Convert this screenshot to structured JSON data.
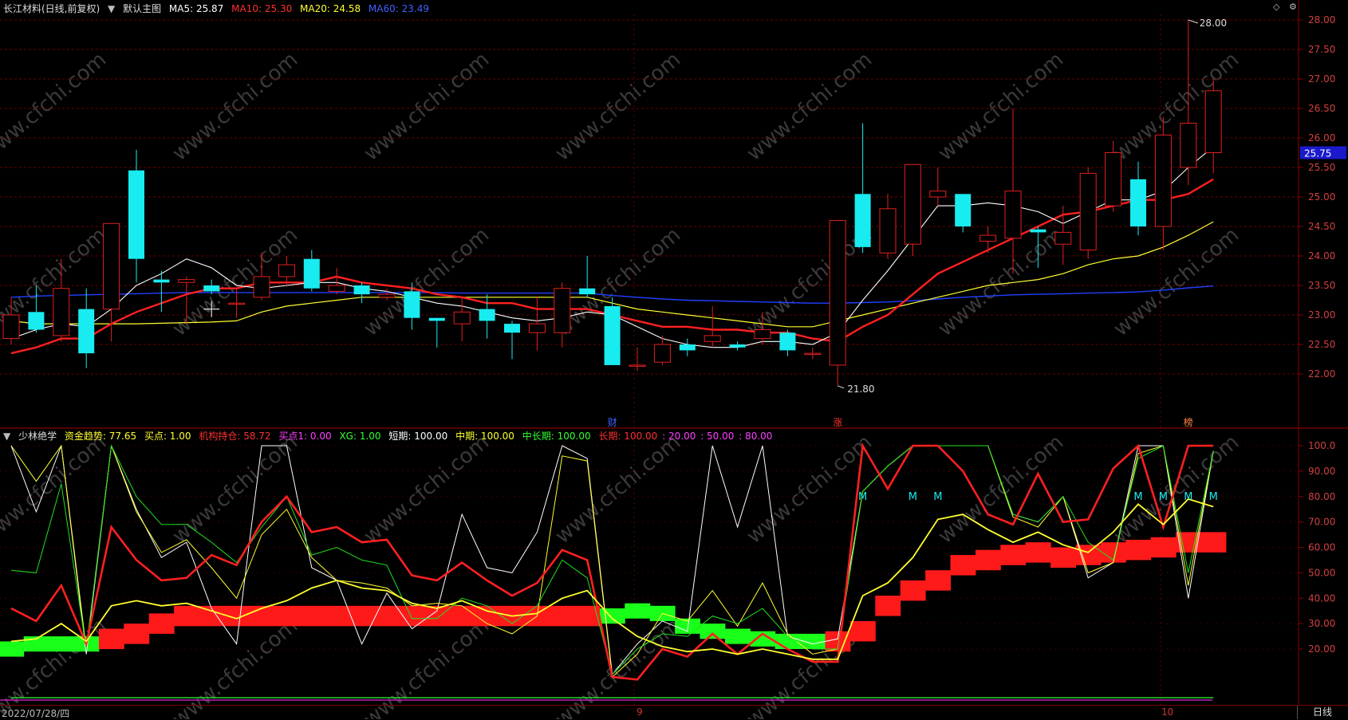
{
  "colors": {
    "up": "#e02020",
    "down": "#19ecf0",
    "ma5": "#ffffff",
    "ma10": "#ff2020",
    "ma20": "#ffff30",
    "ma60": "#2040ff",
    "grid": "#6a0000",
    "axis_text": "#d04040"
  },
  "main_header": {
    "stock": "长江材料(日线,前复权)",
    "menu_icon": "circle-dropdown-icon",
    "chart_name": "默认主图",
    "ma5": "MA5: 25.87",
    "ma10": "MA10: 25.30",
    "ma20": "MA20: 24.58",
    "ma60": "MA60: 23.49"
  },
  "indicator_header": {
    "menu_icon": "circle-dropdown-icon",
    "name": "少林绝学",
    "fund_trend": "资金趋势: 77.65",
    "buy_point": "买点: 1.00",
    "inst_holding": "机构持仓: 58.72",
    "buy_point1": "买点1: 0.00",
    "xg": "XG: 1.00",
    "short_term": "短期: 100.00",
    "mid_term": "中期: 100.00",
    "mid_long_term": "中长期: 100.00",
    "long_term": "长期: 100.00",
    "p20": ": 20.00",
    "p50": ": 50.00",
    "p80": ": 80.00"
  },
  "price_axis": {
    "ticks": [
      "28.00",
      "27.50",
      "27.00",
      "26.50",
      "26.00",
      "25.50",
      "25.00",
      "24.50",
      "24.00",
      "23.50",
      "23.00",
      "22.50",
      "22.00"
    ],
    "current_price": "25.75"
  },
  "indicator_axis": {
    "ticks": [
      "100.0",
      "90.00",
      "80.00",
      "70.00",
      "60.00",
      "50.00",
      "40.00",
      "30.00",
      "20.00"
    ]
  },
  "annotations": {
    "high": "28.00",
    "low": "21.80",
    "m_markers": [
      "M",
      "M",
      "M",
      "M",
      "M",
      "M",
      "M"
    ],
    "event_cai": "财",
    "event_zhang": "涨",
    "event_bang": "榜"
  },
  "watermark": "www.cfchi.com",
  "bottom_bar": {
    "date": "2022/07/28/四",
    "month_9": "9",
    "month_10": "10",
    "period": "日线"
  },
  "chart_data": [
    {
      "type": "candlestick",
      "ylim": [
        21.6,
        28.3
      ],
      "candles": [
        {
          "o": 22.6,
          "c": 23.0,
          "h": 23.3,
          "l": 22.5
        },
        {
          "o": 23.05,
          "c": 22.75,
          "h": 23.5,
          "l": 22.7
        },
        {
          "o": 22.65,
          "c": 23.45,
          "h": 23.95,
          "l": 22.55
        },
        {
          "o": 23.1,
          "c": 22.35,
          "h": 23.45,
          "l": 22.1
        },
        {
          "o": 23.1,
          "c": 24.55,
          "h": 24.55,
          "l": 22.55
        },
        {
          "o": 25.45,
          "c": 23.95,
          "h": 25.8,
          "l": 23.55
        },
        {
          "o": 23.6,
          "c": 23.55,
          "h": 23.75,
          "l": 23.05
        },
        {
          "o": 23.55,
          "c": 23.6,
          "h": 23.65,
          "l": 22.85
        },
        {
          "o": 23.5,
          "c": 23.4,
          "h": 23.6,
          "l": 23.35
        },
        {
          "o": 23.2,
          "c": 23.2,
          "h": 23.45,
          "l": 22.95
        },
        {
          "o": 23.3,
          "c": 23.65,
          "h": 24.05,
          "l": 23.25
        },
        {
          "o": 23.65,
          "c": 23.85,
          "h": 24.0,
          "l": 23.5
        },
        {
          "o": 23.95,
          "c": 23.45,
          "h": 24.1,
          "l": 23.4
        },
        {
          "o": 23.4,
          "c": 23.5,
          "h": 23.8,
          "l": 23.35
        },
        {
          "o": 23.5,
          "c": 23.35,
          "h": 23.55,
          "l": 23.2
        },
        {
          "o": 23.3,
          "c": 23.35,
          "h": 23.45,
          "l": 23.25
        },
        {
          "o": 23.4,
          "c": 22.95,
          "h": 23.55,
          "l": 22.75
        },
        {
          "o": 22.95,
          "c": 22.9,
          "h": 22.95,
          "l": 22.45
        },
        {
          "o": 22.85,
          "c": 23.05,
          "h": 23.3,
          "l": 22.55
        },
        {
          "o": 23.1,
          "c": 22.9,
          "h": 23.35,
          "l": 22.6
        },
        {
          "o": 22.85,
          "c": 22.7,
          "h": 22.9,
          "l": 22.25
        },
        {
          "o": 22.7,
          "c": 22.85,
          "h": 23.3,
          "l": 22.4
        },
        {
          "o": 22.7,
          "c": 23.45,
          "h": 23.55,
          "l": 22.45
        },
        {
          "o": 23.45,
          "c": 23.35,
          "h": 24.0,
          "l": 23.3
        },
        {
          "o": 23.15,
          "c": 22.15,
          "h": 23.3,
          "l": 22.15
        },
        {
          "o": 22.15,
          "c": 22.15,
          "h": 22.45,
          "l": 22.05
        },
        {
          "o": 22.2,
          "c": 22.5,
          "h": 22.65,
          "l": 22.15
        },
        {
          "o": 22.5,
          "c": 22.4,
          "h": 22.6,
          "l": 22.3
        },
        {
          "o": 22.55,
          "c": 22.65,
          "h": 23.15,
          "l": 22.45
        },
        {
          "o": 22.5,
          "c": 22.45,
          "h": 22.55,
          "l": 22.4
        },
        {
          "o": 22.6,
          "c": 22.75,
          "h": 23.05,
          "l": 22.5
        },
        {
          "o": 22.7,
          "c": 22.4,
          "h": 22.75,
          "l": 22.3
        },
        {
          "o": 22.35,
          "c": 22.35,
          "h": 22.45,
          "l": 22.25
        },
        {
          "o": 22.15,
          "c": 24.6,
          "h": 24.6,
          "l": 21.8
        },
        {
          "o": 25.05,
          "c": 24.15,
          "h": 26.25,
          "l": 24.05
        },
        {
          "o": 24.05,
          "c": 24.8,
          "h": 25.05,
          "l": 23.95
        },
        {
          "o": 24.2,
          "c": 25.55,
          "h": 25.55,
          "l": 24.0
        },
        {
          "o": 25.0,
          "c": 25.1,
          "h": 25.5,
          "l": 24.85
        },
        {
          "o": 25.05,
          "c": 24.5,
          "h": 25.05,
          "l": 24.4
        },
        {
          "o": 24.25,
          "c": 24.35,
          "h": 24.5,
          "l": 24.05
        },
        {
          "o": 24.3,
          "c": 25.1,
          "h": 26.5,
          "l": 23.7
        },
        {
          "o": 24.45,
          "c": 24.4,
          "h": 24.5,
          "l": 23.8
        },
        {
          "o": 24.2,
          "c": 24.4,
          "h": 24.85,
          "l": 23.85
        },
        {
          "o": 24.1,
          "c": 25.4,
          "h": 25.5,
          "l": 23.95
        },
        {
          "o": 24.85,
          "c": 25.75,
          "h": 25.95,
          "l": 24.75
        },
        {
          "o": 25.3,
          "c": 24.5,
          "h": 25.6,
          "l": 24.35
        },
        {
          "o": 24.5,
          "c": 26.05,
          "h": 26.35,
          "l": 24.1
        },
        {
          "o": 25.5,
          "c": 26.25,
          "h": 28.0,
          "l": 25.2
        },
        {
          "o": 25.75,
          "c": 26.8,
          "h": 27.0,
          "l": 25.4
        }
      ],
      "ma5": [
        22.6,
        22.75,
        22.85,
        22.8,
        23.1,
        23.5,
        23.7,
        23.95,
        23.8,
        23.5,
        23.45,
        23.5,
        23.55,
        23.55,
        23.45,
        23.4,
        23.3,
        23.2,
        23.15,
        23.05,
        22.95,
        22.9,
        22.95,
        23.05,
        23.0,
        22.8,
        22.6,
        22.5,
        22.45,
        22.45,
        22.55,
        22.55,
        22.5,
        22.7,
        23.25,
        23.75,
        24.3,
        24.85,
        24.85,
        24.9,
        24.85,
        24.75,
        24.55,
        24.75,
        24.95,
        24.95,
        25.1,
        25.5,
        25.85
      ],
      "ma10": [
        22.35,
        22.45,
        22.6,
        22.6,
        22.85,
        23.05,
        23.2,
        23.35,
        23.45,
        23.45,
        23.55,
        23.55,
        23.55,
        23.65,
        23.55,
        23.5,
        23.45,
        23.35,
        23.3,
        23.2,
        23.2,
        23.1,
        23.1,
        23.1,
        23.0,
        22.9,
        22.8,
        22.8,
        22.75,
        22.75,
        22.7,
        22.7,
        22.6,
        22.55,
        22.8,
        23.0,
        23.35,
        23.7,
        23.9,
        24.1,
        24.3,
        24.5,
        24.7,
        24.75,
        24.85,
        24.95,
        24.95,
        25.05,
        25.3
      ],
      "ma20": [
        22.9,
        22.85,
        22.85,
        22.85,
        22.85,
        22.85,
        22.86,
        22.87,
        22.88,
        22.9,
        23.05,
        23.15,
        23.2,
        23.25,
        23.3,
        23.3,
        23.3,
        23.3,
        23.3,
        23.3,
        23.3,
        23.3,
        23.3,
        23.3,
        23.2,
        23.1,
        23.05,
        23.0,
        22.95,
        22.9,
        22.85,
        22.8,
        22.8,
        22.9,
        23.0,
        23.1,
        23.2,
        23.3,
        23.4,
        23.5,
        23.55,
        23.6,
        23.7,
        23.85,
        23.95,
        24.0,
        24.15,
        24.35,
        24.58
      ],
      "ma60": [
        23.3,
        23.32,
        23.33,
        23.34,
        23.35,
        23.36,
        23.37,
        23.38,
        23.38,
        23.38,
        23.38,
        23.38,
        23.38,
        23.38,
        23.38,
        23.38,
        23.38,
        23.38,
        23.37,
        23.37,
        23.37,
        23.37,
        23.37,
        23.37,
        23.33,
        23.3,
        23.27,
        23.25,
        23.24,
        23.23,
        23.22,
        23.21,
        23.2,
        23.2,
        23.21,
        23.22,
        23.24,
        23.27,
        23.3,
        23.32,
        23.34,
        23.35,
        23.36,
        23.37,
        23.38,
        23.39,
        23.42,
        23.46,
        23.49
      ]
    },
    {
      "type": "line",
      "ylim": [
        0,
        102
      ],
      "series": [
        {
          "name": "短期",
          "values": [
            100,
            74,
            100,
            18,
            100,
            75,
            56,
            62,
            36,
            22,
            100,
            100,
            52,
            47,
            22,
            42,
            28,
            35,
            73,
            52,
            50,
            66,
            100,
            95,
            10,
            22,
            31,
            27,
            100,
            68,
            100,
            25,
            22,
            24,
            82,
            92,
            100,
            100,
            100,
            100,
            73,
            70,
            80,
            48,
            54,
            100,
            100,
            40,
            98
          ]
        },
        {
          "name": "中期",
          "values": [
            100,
            86,
            100,
            20,
            100,
            74,
            58,
            63,
            52,
            40,
            65,
            75,
            56,
            47,
            46,
            44,
            37,
            38,
            37,
            30,
            26,
            33,
            96,
            94,
            9,
            18,
            34,
            31,
            43,
            29,
            46,
            26,
            18,
            20,
            82,
            92,
            100,
            100,
            100,
            100,
            72,
            68,
            80,
            50,
            54,
            97,
            100,
            45,
            98
          ]
        },
        {
          "name": "中长期",
          "values": [
            51,
            50,
            85,
            20,
            100,
            80,
            69,
            69,
            62,
            54,
            68,
            80,
            57,
            60,
            55,
            53,
            32,
            32,
            40,
            37,
            30,
            37,
            55,
            48,
            10,
            20,
            26,
            25,
            33,
            30,
            36,
            25,
            20,
            20,
            82,
            92,
            100,
            100,
            100,
            100,
            73,
            70,
            80,
            62,
            55,
            95,
            100,
            50,
            98
          ]
        },
        {
          "name": "长期",
          "values": [
            36,
            31,
            45,
            22,
            68,
            55,
            47,
            48,
            57,
            53,
            70,
            80,
            66,
            68,
            62,
            63,
            49,
            47,
            54,
            47,
            41,
            46,
            59,
            55,
            9,
            8,
            20,
            17,
            26,
            18,
            26,
            20,
            15,
            15,
            100,
            83,
            100,
            100,
            90,
            73,
            69,
            89,
            70,
            71,
            91,
            100,
            68,
            100,
            100
          ]
        },
        {
          "name": "资金趋势",
          "values": [
            23,
            24,
            30,
            23,
            37,
            39,
            37,
            38,
            35,
            32,
            36,
            39,
            44,
            47,
            44,
            43,
            38,
            36,
            39,
            35,
            33,
            34,
            40,
            43,
            32,
            25,
            21,
            19,
            20,
            18,
            20,
            18,
            16,
            16,
            41,
            46,
            56,
            71,
            73,
            67,
            62,
            66,
            61,
            58,
            66,
            77,
            69,
            79,
            76
          ]
        },
        {
          "name": "机构持仓",
          "values": [
            20,
            22,
            22,
            22,
            24,
            26,
            30,
            33,
            33,
            33,
            33,
            33,
            33,
            33,
            33,
            33,
            33,
            33,
            33,
            33,
            33,
            33,
            33,
            33,
            33,
            35,
            34,
            29,
            27,
            25,
            24,
            23,
            23,
            23,
            27,
            37,
            43,
            47,
            53,
            55,
            57,
            58,
            56,
            57,
            58,
            59,
            60,
            62,
            62
          ]
        },
        {
          "name": "买点",
          "values": [
            1,
            1,
            1,
            1,
            1,
            1,
            1,
            1,
            1,
            1,
            1,
            1,
            1,
            1,
            1,
            1,
            1,
            1,
            1,
            1,
            1,
            1,
            1,
            1,
            1,
            1,
            1,
            1,
            1,
            1,
            1,
            1,
            1,
            1,
            1,
            1,
            1,
            1,
            1,
            1,
            1,
            1,
            1,
            1,
            1,
            1,
            1,
            1,
            1
          ]
        }
      ]
    }
  ]
}
